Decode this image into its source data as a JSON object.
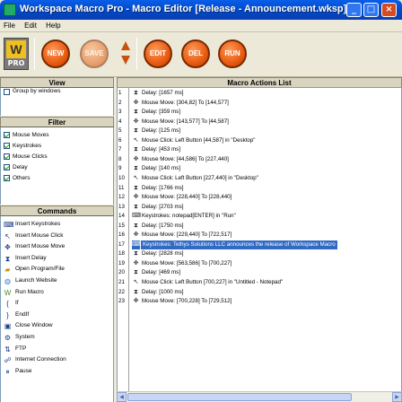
{
  "window": {
    "title": "Workspace Macro Pro - Macro Editor [Release - Announcement.wksp]",
    "minimize": "_",
    "maximize": "□",
    "close": "×"
  },
  "menu": [
    "File",
    "Edit",
    "Help"
  ],
  "toolbar": {
    "logo_letter": "W",
    "logo_sub": "PRO",
    "buttons": [
      "NEW",
      "SAVE",
      "EDIT",
      "DEL",
      "RUN"
    ]
  },
  "view": {
    "header": "View",
    "items": [
      {
        "label": "Group by windows",
        "checked": false
      }
    ]
  },
  "filter": {
    "header": "Filter",
    "items": [
      {
        "label": "Mouse Moves",
        "checked": true
      },
      {
        "label": "Keystrokes",
        "checked": true
      },
      {
        "label": "Mouse Clicks",
        "checked": true
      },
      {
        "label": "Delay",
        "checked": true
      },
      {
        "label": "Others",
        "checked": true
      }
    ]
  },
  "commands": {
    "header": "Commands",
    "items": [
      {
        "label": "Insert Keystrokes",
        "icon": "keyboard-icon"
      },
      {
        "label": "Insert Mouse Click",
        "icon": "mouse-click-icon"
      },
      {
        "label": "Insert Mouse Move",
        "icon": "mouse-move-icon"
      },
      {
        "label": "Insert Delay",
        "icon": "hourglass-icon"
      },
      {
        "label": "Open Program/File",
        "icon": "folder-open-icon"
      },
      {
        "label": "Launch Website",
        "icon": "globe-icon"
      },
      {
        "label": "Run Macro",
        "icon": "run-macro-icon"
      },
      {
        "label": "If",
        "icon": "if-icon"
      },
      {
        "label": "EndIf",
        "icon": "endif-icon"
      },
      {
        "label": "Close Window",
        "icon": "close-window-icon"
      },
      {
        "label": "System",
        "icon": "system-icon"
      },
      {
        "label": "FTP",
        "icon": "ftp-icon"
      },
      {
        "label": "Internet Connection",
        "icon": "internet-connection-icon"
      },
      {
        "label": "Pause",
        "icon": "pause-icon"
      }
    ]
  },
  "actions": {
    "header": "Macro Actions List",
    "rows": [
      {
        "num": "1",
        "icon": "hourglass-icon",
        "text": "Delay: [1657 ms]"
      },
      {
        "num": "2",
        "icon": "mouse-move-icon",
        "text": "Mouse Move: [304,82] To [144,577]"
      },
      {
        "num": "3",
        "icon": "hourglass-icon",
        "text": "Delay: [359 ms]"
      },
      {
        "num": "4",
        "icon": "mouse-move-icon",
        "text": "Mouse Move: [143,577] To [44,587]"
      },
      {
        "num": "5",
        "icon": "hourglass-icon",
        "text": "Delay: [125 ms]"
      },
      {
        "num": "6",
        "icon": "mouse-click-icon",
        "text": "Mouse Click: Left Button [44,587] in \"Desktop\""
      },
      {
        "num": "7",
        "icon": "hourglass-icon",
        "text": "Delay: [453 ms]"
      },
      {
        "num": "8",
        "icon": "mouse-move-icon",
        "text": "Mouse Move: [44,586] To [227,440]"
      },
      {
        "num": "9",
        "icon": "hourglass-icon",
        "text": "Delay: [140 ms]"
      },
      {
        "num": "10",
        "icon": "mouse-click-icon",
        "text": "Mouse Click: Left Button [227,440] in \"Desktop\""
      },
      {
        "num": "11",
        "icon": "hourglass-icon",
        "text": "Delay: [1766 ms]"
      },
      {
        "num": "12",
        "icon": "mouse-move-icon",
        "text": "Mouse Move: [228,440] To [228,440]"
      },
      {
        "num": "13",
        "icon": "hourglass-icon",
        "text": "Delay: [2703 ms]"
      },
      {
        "num": "14",
        "icon": "keyboard-icon",
        "text": "Keystrokes: notepad[ENTER] in \"Run\""
      },
      {
        "num": "15",
        "icon": "hourglass-icon",
        "text": "Delay: [1750 ms]"
      },
      {
        "num": "16",
        "icon": "mouse-move-icon",
        "text": "Mouse Move: [229,440] To [722,517]"
      },
      {
        "num": "17",
        "icon": "keyboard-icon",
        "text": "Keystrokes: Tethys Solutions LLC announces the release of Workspace Macro",
        "selected": true
      },
      {
        "num": "18",
        "icon": "hourglass-icon",
        "text": "Delay: [2828 ms]"
      },
      {
        "num": "19",
        "icon": "mouse-move-icon",
        "text": "Mouse Move: [563,586] To [700,227]"
      },
      {
        "num": "20",
        "icon": "hourglass-icon",
        "text": "Delay: [469 ms]"
      },
      {
        "num": "21",
        "icon": "mouse-click-icon",
        "text": "Mouse Click: Left Button [700,227] in \"Untitled - Notepad\""
      },
      {
        "num": "22",
        "icon": "hourglass-icon",
        "text": "Delay: [1000 ms]"
      },
      {
        "num": "23",
        "icon": "mouse-move-icon",
        "text": "Mouse Move: [700,228] To [729,512]"
      }
    ]
  },
  "colors": {
    "title_blue": "#0a5ee8",
    "button_orange": "#e85a10",
    "selection": "#316ac5"
  }
}
